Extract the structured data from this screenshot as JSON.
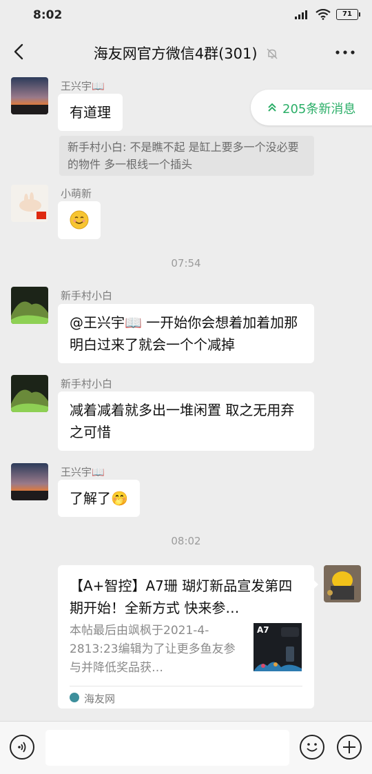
{
  "status": {
    "time": "8:02",
    "battery": "71"
  },
  "header": {
    "title": "海友网官方微信4群(301)"
  },
  "new_messages": {
    "label": "205条新消息"
  },
  "messages": [
    {
      "sender": "王兴宇📖",
      "text": "有道理",
      "quote": "新手村小白: 不是瞧不起   是缸上要多一个没必要的物件  多一根线一个插头"
    },
    {
      "sender": "小萌新",
      "text": "😊"
    },
    {
      "time": "07:54"
    },
    {
      "sender": "新手村小白",
      "text": "@王兴宇📖 一开始你会想着加着加那   明白过来了就会一个个减掉"
    },
    {
      "sender": "新手村小白",
      "text": "减着减着就多出一堆闲置   取之无用弃之可惜"
    },
    {
      "sender": "王兴宇📖",
      "text": "了解了🤭"
    },
    {
      "time": "08:02"
    },
    {
      "card": {
        "title": "【A+智控】A7珊 瑚灯新品宣发第四期开始！全新方式  快来参…",
        "desc": "本帖最后由飒枫于2021-4-2813:23编辑为了让更多鱼友参与并降低奖品获…",
        "thumb_label": "A7",
        "source": "海友网"
      }
    }
  ],
  "colors": {
    "accent_green": "#2aae67",
    "bg": "#ededed"
  }
}
